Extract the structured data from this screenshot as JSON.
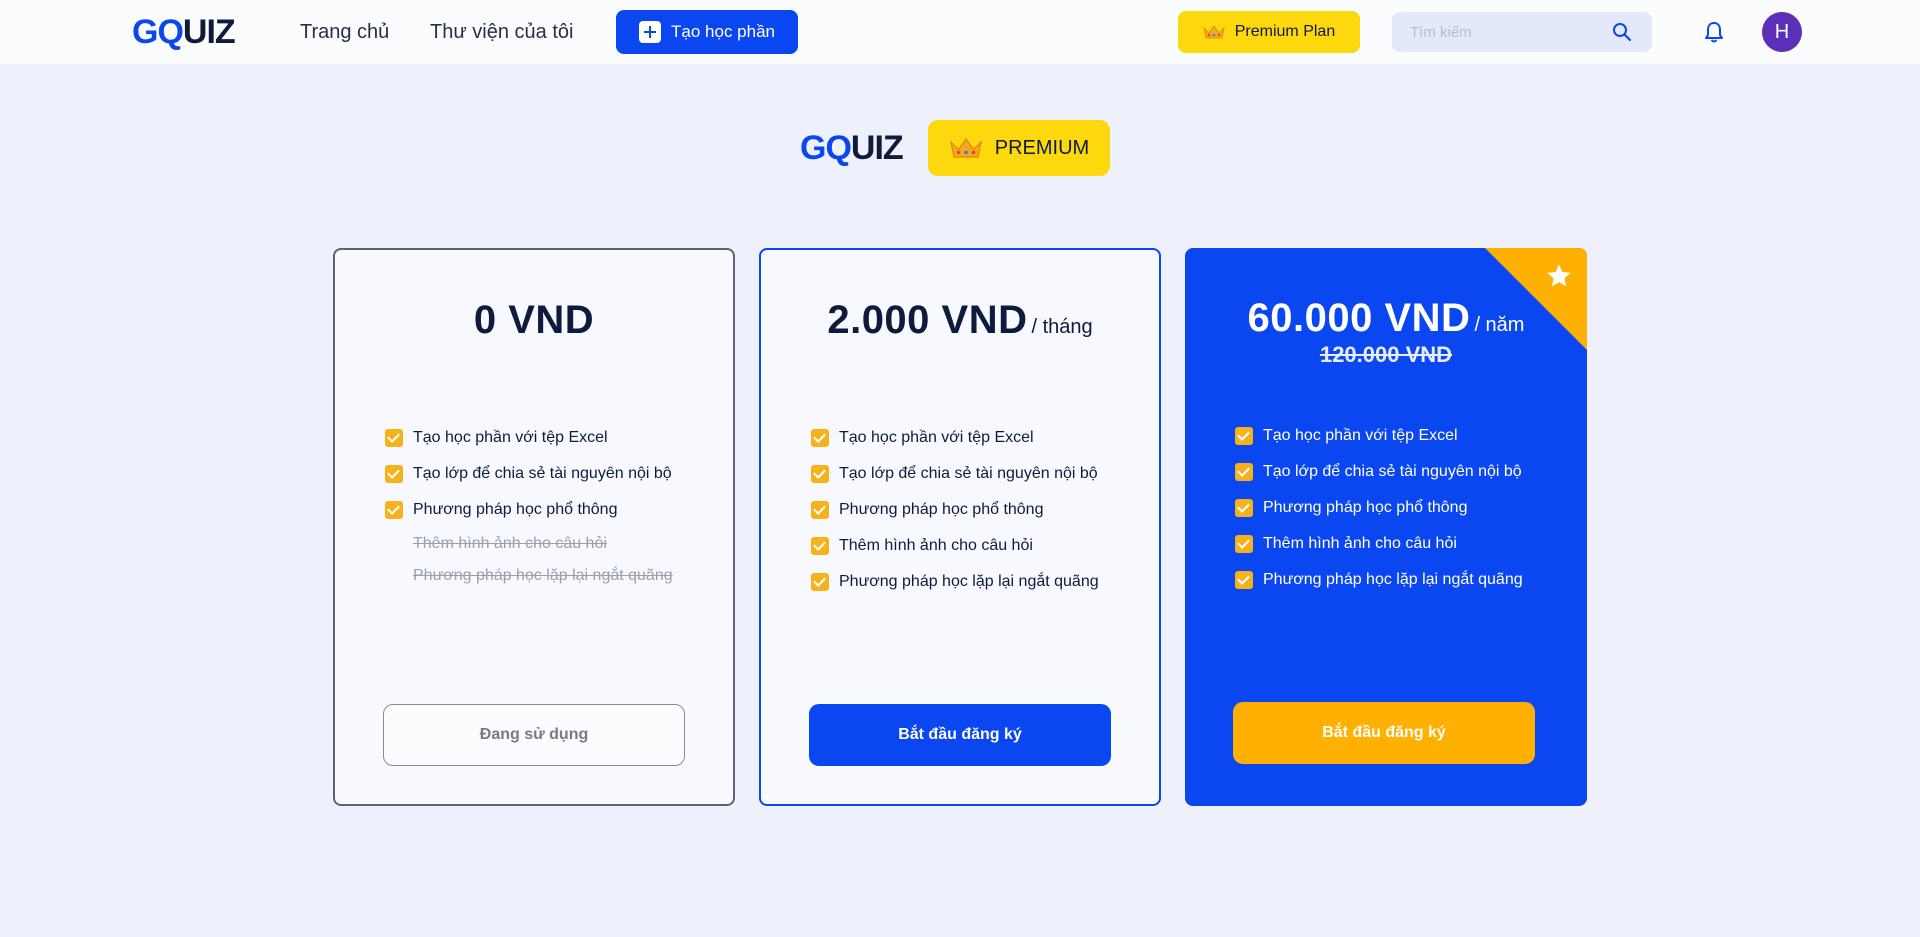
{
  "header": {
    "logo_part1": "GQ",
    "logo_part2": "UIZ",
    "nav_home": "Trang chủ",
    "nav_library": "Thư viện của tôi",
    "create_label": "Tạo học phần",
    "premium_label": "Premium Plan",
    "search_placeholder": "Tìm kiếm",
    "avatar_initial": "H"
  },
  "banner": {
    "logo_part1": "GQ",
    "logo_part2": "UIZ",
    "badge_label": "PREMIUM"
  },
  "plans": [
    {
      "amount": "0 VND",
      "unit": "",
      "features": [
        {
          "label": "Tạo học phần với tệp Excel",
          "included": true
        },
        {
          "label": "Tạo lớp để chia sẻ tài nguyên nội bộ",
          "included": true
        },
        {
          "label": "Phương pháp học phổ thông",
          "included": true
        },
        {
          "label": "Thêm hình ảnh cho câu hỏi",
          "included": false
        },
        {
          "label": "Phương pháp học lặp lại ngắt quãng",
          "included": false
        }
      ],
      "button_label": "Đang sử dụng"
    },
    {
      "amount": "2.000 VND",
      "unit": "/ tháng",
      "features": [
        {
          "label": "Tạo học phần với tệp Excel",
          "included": true
        },
        {
          "label": "Tạo lớp để chia sẻ tài nguyên nội bộ",
          "included": true
        },
        {
          "label": "Phương pháp học phổ thông",
          "included": true
        },
        {
          "label": "Thêm hình ảnh cho câu hỏi",
          "included": true
        },
        {
          "label": "Phương pháp học lặp lại ngắt quãng",
          "included": true
        }
      ],
      "button_label": "Bắt đầu đăng ký"
    },
    {
      "amount": "60.000 VND",
      "unit": "/ năm",
      "old_price": "120.000 VND",
      "features": [
        {
          "label": "Tạo học phần với tệp Excel",
          "included": true
        },
        {
          "label": "Tạo lớp để chia sẻ tài nguyên nội bộ",
          "included": true
        },
        {
          "label": "Phương pháp học phổ thông",
          "included": true
        },
        {
          "label": "Thêm hình ảnh cho câu hỏi",
          "included": true
        },
        {
          "label": "Phương pháp học lặp lại ngắt quãng",
          "included": true
        }
      ],
      "button_label": "Bắt đầu đăng ký"
    }
  ],
  "colors": {
    "brand_blue": "#0a47f0",
    "premium_yellow": "#fcd80c",
    "accent_orange": "#ffb000",
    "check_orange": "#f6b21a",
    "page_bg": "#eef1fb"
  }
}
